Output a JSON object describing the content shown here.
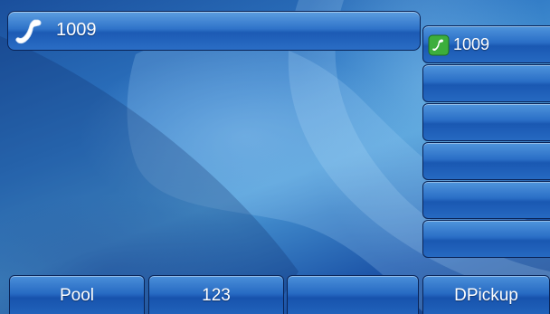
{
  "titlebar": {
    "text": "1009",
    "icon": "handset-icon"
  },
  "line_keys": [
    {
      "label": "1009",
      "icon": "phone-registered-icon"
    },
    {
      "label": ""
    },
    {
      "label": ""
    },
    {
      "label": ""
    },
    {
      "label": ""
    },
    {
      "label": ""
    }
  ],
  "softkeys": [
    {
      "label": "Pool"
    },
    {
      "label": "123"
    },
    {
      "label": ""
    },
    {
      "label": "DPickup"
    }
  ],
  "colors": {
    "button_blue": "#2a6ec6",
    "border": "#0a2457",
    "line_icon_green": "#3cae3c"
  }
}
